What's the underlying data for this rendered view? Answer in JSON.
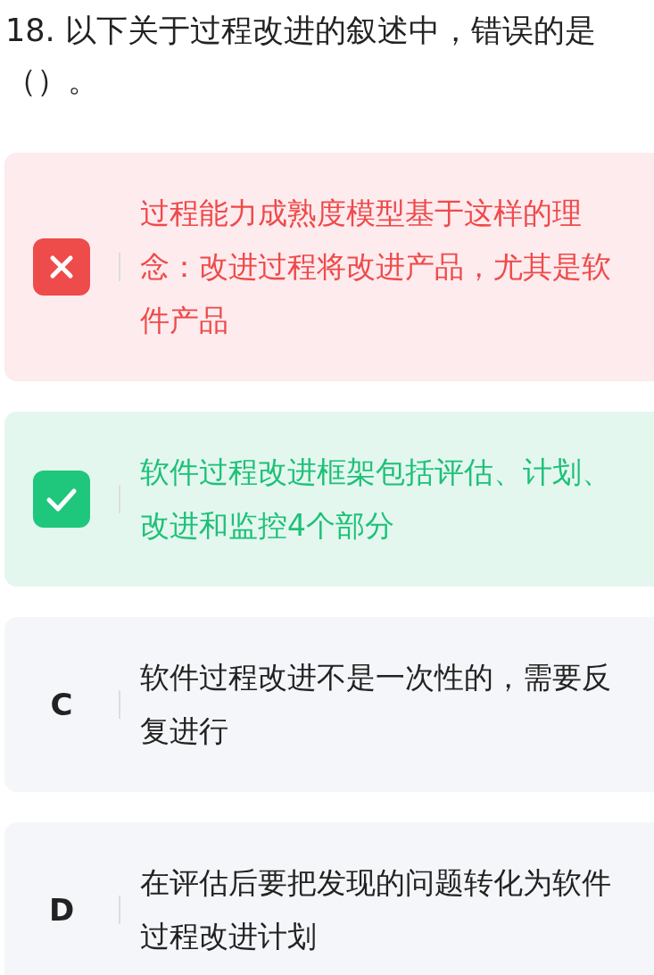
{
  "question": {
    "text": "18. 以下关于过程改进的叙述中，错误的是（）。"
  },
  "options": [
    {
      "kind": "wrong",
      "text": "过程能力成熟度模型基于这样的理念：改进过程将改进产品，尤其是软件产品"
    },
    {
      "kind": "correct",
      "text": "软件过程改进框架包括评估、计划、改进和监控4个部分"
    },
    {
      "kind": "plain",
      "letter": "C",
      "text": "软件过程改进不是一次性的，需要反复进行"
    },
    {
      "kind": "plain",
      "letter": "D",
      "text": "在评估后要把发现的问题转化为软件过程改进计划"
    }
  ]
}
